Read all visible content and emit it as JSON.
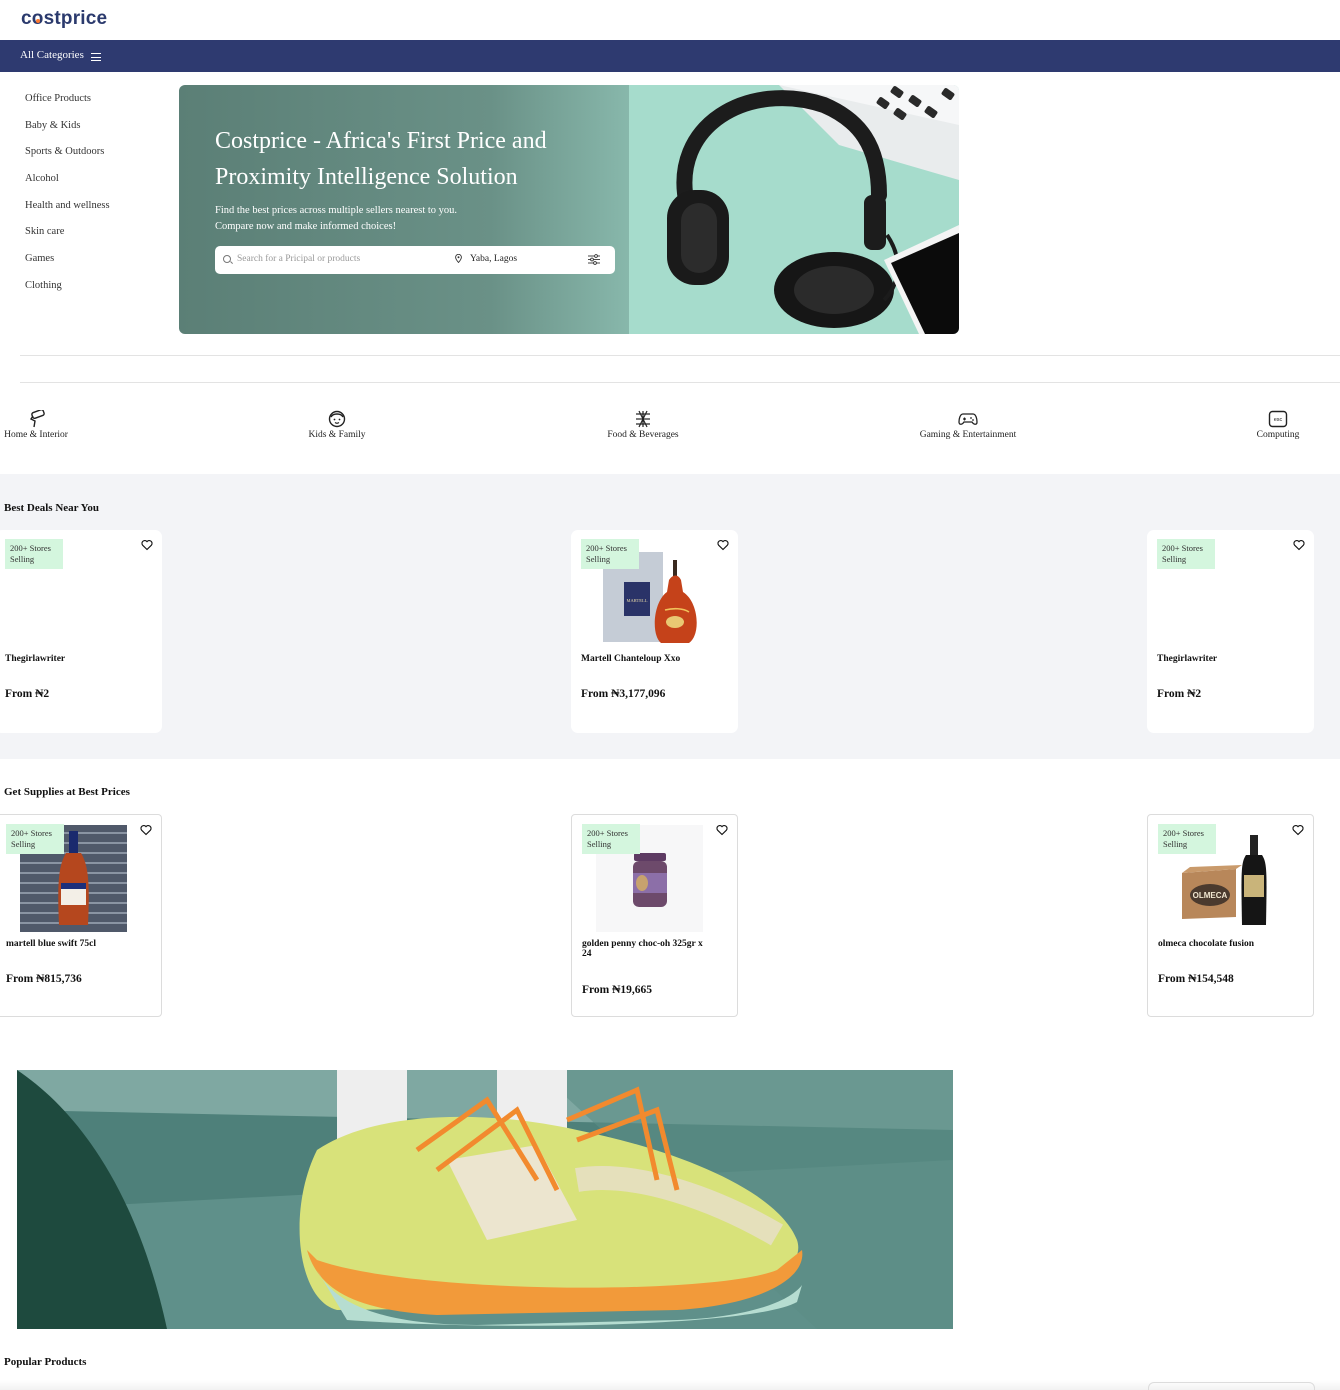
{
  "brand": {
    "logo_text": "costprice",
    "accent": "#2e3a70",
    "dot_color": "#ff7a2f",
    "badge_color": "#d4f6de"
  },
  "nav": {
    "all_categories": "All Categories"
  },
  "sidebar": {
    "items": [
      {
        "label": "Office Products"
      },
      {
        "label": "Baby & Kids"
      },
      {
        "label": "Sports & Outdoors"
      },
      {
        "label": "Alcohol"
      },
      {
        "label": "Health and wellness"
      },
      {
        "label": "Skin care"
      },
      {
        "label": "Games"
      },
      {
        "label": "Clothing"
      }
    ]
  },
  "hero": {
    "title": "Costprice - Africa's First Price and Proximity Intelligence Solution",
    "subtitle_line1": "Find the best prices across multiple sellers nearest to you.",
    "subtitle_line2": "Compare now and make informed choices!",
    "search_placeholder": "Search for a Pricipal or products",
    "location": "Yaba, Lagos"
  },
  "quick_categories": [
    {
      "label": "Home & Interior",
      "icon": "paint-roller-icon"
    },
    {
      "label": "Kids & Family",
      "icon": "child-face-icon"
    },
    {
      "label": "Food & Beverages",
      "icon": "utensils-icon"
    },
    {
      "label": "Gaming & Entertainment",
      "icon": "gamepad-icon"
    },
    {
      "label": "Computing",
      "icon": "esc-key-icon"
    }
  ],
  "best_deals": {
    "title": "Best Deals Near You",
    "cards": [
      {
        "badge": "200+ Stores Selling",
        "name": "Thegirlawriter",
        "price": "From ₦2"
      },
      {
        "badge": "200+ Stores Selling",
        "name": "Martell Chanteloup Xxo",
        "price": "From ₦3,177,096"
      },
      {
        "badge": "200+ Stores Selling",
        "name": "Thegirlawriter",
        "price": "From ₦2"
      }
    ]
  },
  "supplies": {
    "title": "Get Supplies at Best Prices",
    "cards": [
      {
        "badge": "200+ Stores Selling",
        "name": "martell blue swift 75cl",
        "price": "From ₦815,736"
      },
      {
        "badge": "200+ Stores Selling",
        "name": "golden penny choc-oh 325gr x 24",
        "price": "From ₦19,665"
      },
      {
        "badge": "200+ Stores Selling",
        "name": "olmeca chocolate fusion",
        "price": "From ₦154,548"
      }
    ]
  },
  "popular": {
    "title": "Popular Products"
  }
}
